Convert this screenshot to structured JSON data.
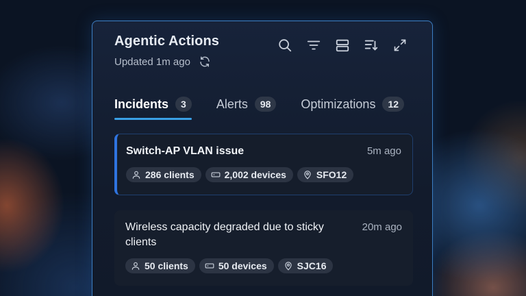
{
  "panel": {
    "title": "Agentic Actions",
    "updated": "Updated 1m ago"
  },
  "toolbar": {
    "icons": [
      "search-icon",
      "filter-icon",
      "layout-icon",
      "sort-icon",
      "expand-icon"
    ]
  },
  "tabs": [
    {
      "label": "Incidents",
      "count": "3",
      "active": true
    },
    {
      "label": "Alerts",
      "count": "98",
      "active": false
    },
    {
      "label": "Optimizations",
      "count": "12",
      "active": false
    }
  ],
  "incidents": [
    {
      "title": "Switch-AP VLAN issue",
      "time": "5m ago",
      "clients": "286 clients",
      "devices": "2,002 devices",
      "site": "SFO12"
    },
    {
      "title": "Wireless capacity degraded due to sticky clients",
      "time": "20m ago",
      "clients": "50 clients",
      "devices": "50 devices",
      "site": "SJC16"
    }
  ],
  "colors": {
    "accent": "#3aa0e6",
    "selected_bar": "#2f74e0",
    "panel_border": "#3c7fc4"
  }
}
